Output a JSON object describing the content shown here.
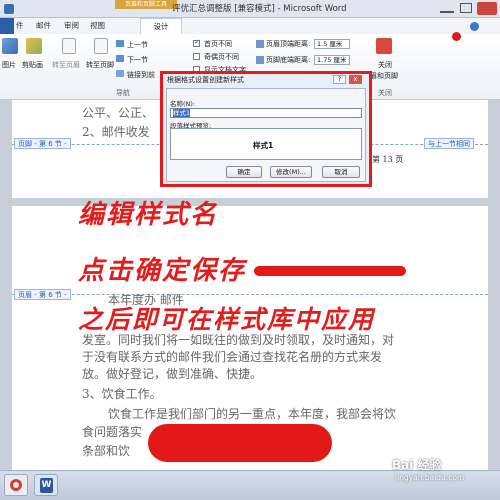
{
  "window": {
    "title": "评优汇总调整版 [兼容模式] - Microsoft Word",
    "context_tab": "页眉和页脚工具",
    "tabs": [
      "件",
      "邮件",
      "审阅",
      "视图"
    ],
    "active_tab": "设计"
  },
  "ribbon": {
    "pics_label": "图片",
    "clip_label": "剪贴画",
    "goto_header": "转至页眉",
    "goto_footer": "转至页脚",
    "prev_section": "上一节",
    "next_section": "下一节",
    "link_prev": "链接到前",
    "nav_group": "导航",
    "opt_first_page": "首页不同",
    "opt_odd_even": "奇偶页不同",
    "opt_show_text": "显示文档文字",
    "header_top_label": "页眉顶端距离:",
    "header_top_value": "1.5 厘米",
    "footer_bottom_label": "页脚底端距离:",
    "footer_bottom_value": "1.75 厘米",
    "close_label": "关闭",
    "close_sub": "眉和页脚",
    "close_group": "关闭"
  },
  "document": {
    "line1": "公平、公正、",
    "line2": "2、邮件收发",
    "footer_tag": "页脚 - 第 6 节 -",
    "same_as_prev": "与上一节相同",
    "page_no": "第 13 页",
    "header_tag": "页眉 - 第 6 节 -",
    "para1": "本年度办 邮件",
    "para1_line2": "发室。同时我们将一如既往的做到及时领取，及时通知，对",
    "para1_line3": "于没有联系方式的邮件我们会通过查找花名册的方式来发",
    "para1_line4": "放。做好登记，做到准确、快捷。",
    "item3": "3、饮食工作。",
    "para2": "饮食工作是我们部门的另一重点，本年度，我部会将饮",
    "para2_line2": "食问题落实",
    "para2_line3": "条部和饮"
  },
  "annotations": {
    "edit_name": "编辑样式名",
    "click_save": "点击确定保存",
    "then_apply": "之后即可在样式库中应用"
  },
  "dialog": {
    "title": "根据格式设置创建新样式",
    "name_label": "名称(N):",
    "name_value": "样式1",
    "preview_label": "段落样式预览:",
    "preview_text": "样式1",
    "ok": "确定",
    "modify": "修改(M)...",
    "cancel": "取消",
    "help": "?",
    "close": "x"
  },
  "taskbar": {
    "watermark_brand": "Bai 经验",
    "watermark_url": "jingyan.baidu.com"
  },
  "colors": {
    "annotation": "#e11d1d",
    "dialog_border": "#e41b1b",
    "ribbon_bg": "#edf1f6",
    "page_bg": "#ffffff"
  }
}
